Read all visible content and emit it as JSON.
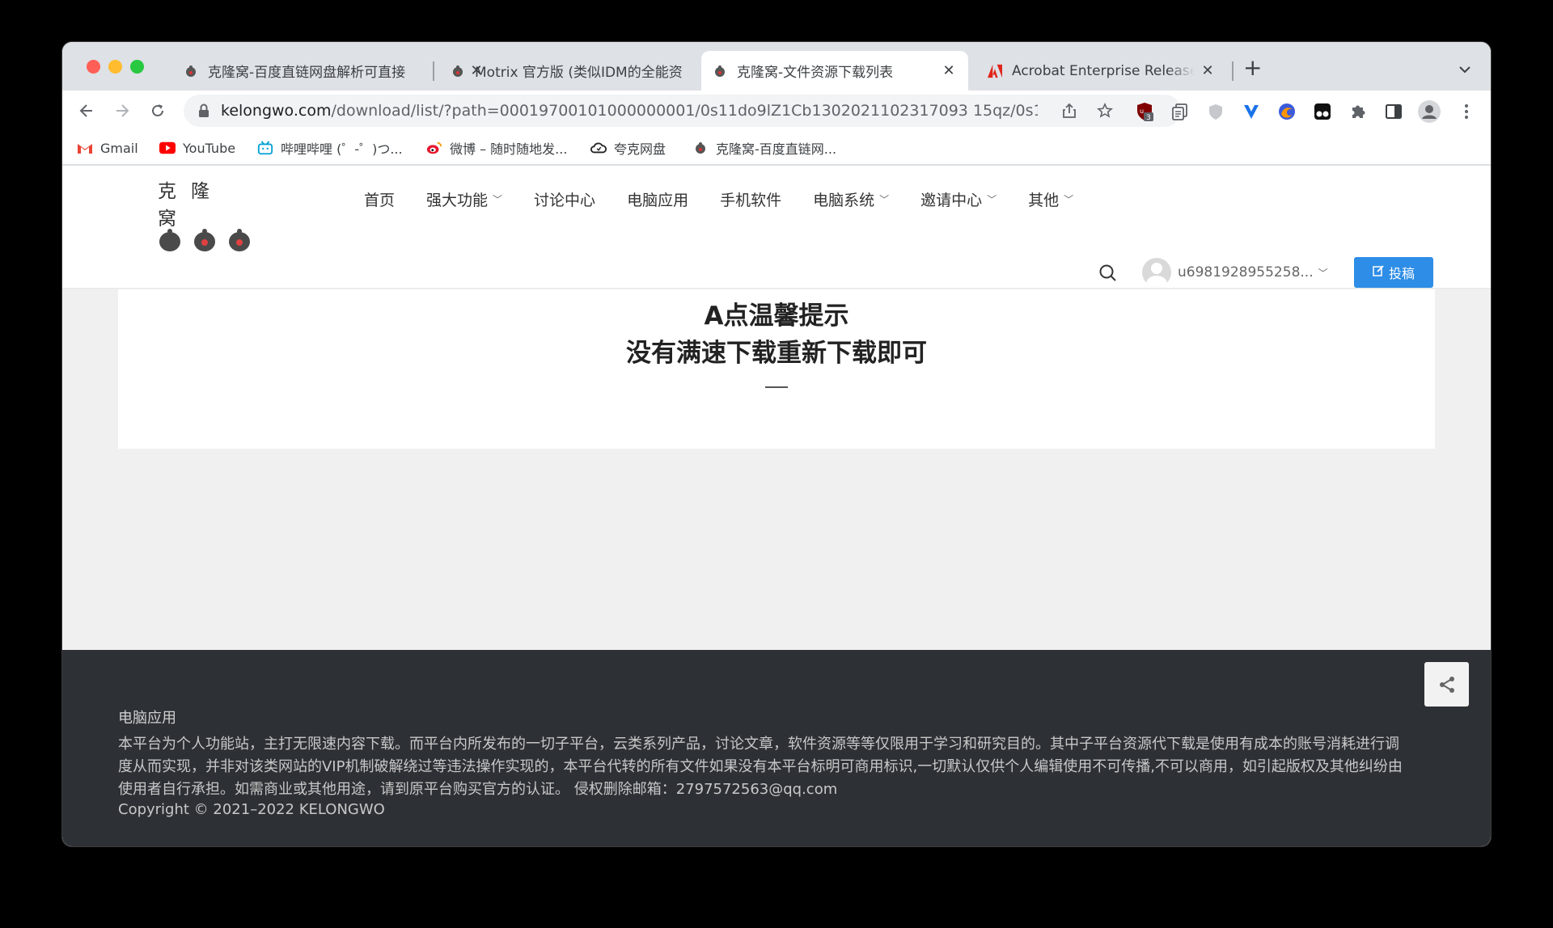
{
  "browser": {
    "tabs": [
      {
        "title": "克隆窝-百度直链网盘解析可直接",
        "active": false
      },
      {
        "title": "Motrix 官方版 (类似IDM的全能资",
        "active": false
      },
      {
        "title": "克隆窝-文件资源下载列表",
        "active": true
      },
      {
        "title": "Acrobat Enterprise Release Notes",
        "active": false
      }
    ],
    "url_host": "kelongwo.com",
    "url_path": "/download/list/?path=00019700101000000001/0s11do9lZ1Cb1302021102317093 15qz/0s11do9l...",
    "extension_badge": "3",
    "bookmarks": [
      {
        "label": "Gmail",
        "icon": "gmail-icon"
      },
      {
        "label": "YouTube",
        "icon": "youtube-icon"
      },
      {
        "label": "哔哩哔哩 (゜-゜)つ...",
        "icon": "bilibili-icon"
      },
      {
        "label": "微博 – 随时随地发...",
        "icon": "weibo-icon"
      },
      {
        "label": "夸克网盘",
        "icon": "cloud-icon"
      },
      {
        "label": "克隆窝-百度直链网...",
        "icon": "kelongwo-icon"
      }
    ]
  },
  "site": {
    "logo_text": "克隆窝",
    "nav": [
      {
        "label": "首页",
        "dropdown": false
      },
      {
        "label": "强大功能",
        "dropdown": true
      },
      {
        "label": "讨论中心",
        "dropdown": false
      },
      {
        "label": "电脑应用",
        "dropdown": false
      },
      {
        "label": "手机软件",
        "dropdown": false
      },
      {
        "label": "电脑系统",
        "dropdown": true
      },
      {
        "label": "邀请中心",
        "dropdown": true
      },
      {
        "label": "其他",
        "dropdown": true
      }
    ],
    "username": "u6981928955258...",
    "post_button": "投稿"
  },
  "notice": {
    "line1": "A点温馨提示",
    "line2": "没有满速下载重新下载即可"
  },
  "footer": {
    "title": "电脑应用",
    "description": "本平台为个人功能站，主打无限速内容下载。而平台内所发布的一切子平台，云类系列产品，讨论文章，软件资源等等仅限用于学习和研究目的。其中子平台资源代下载是使用有成本的账号消耗进行调度从而实现，并非对该类网站的VIP机制破解绕过等违法操作实现的，本平台代转的所有文件如果没有本平台标明可商用标识,一切默认仅供个人编辑使用不可传播,不可以商用，如引起版权及其他纠纷由使用者自行承担。如需商业或其他用途，请到原平台购买官方的认证。 侵权删除邮箱：2797572563@qq.com",
    "copyright": "Copyright © 2021–2022 KELONGWO"
  },
  "colors": {
    "accent": "#2e8de6",
    "footer_bg": "#2d3035",
    "page_bg": "#f0f0f0"
  }
}
